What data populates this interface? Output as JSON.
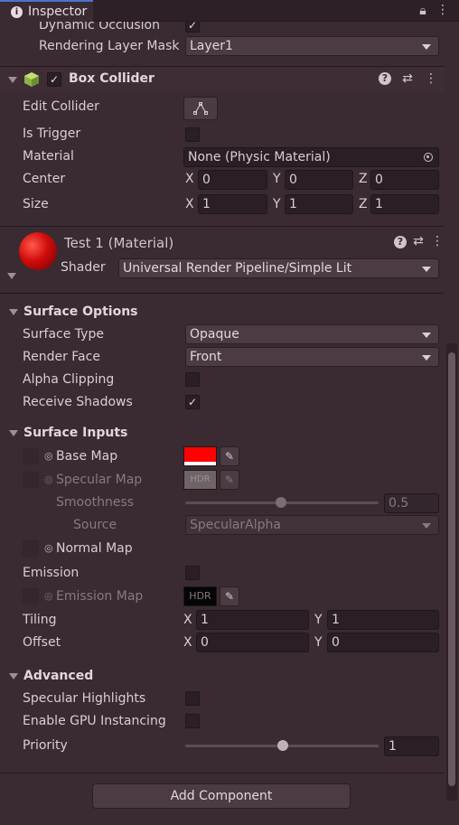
{
  "tab": {
    "title": "Inspector"
  },
  "partial_rows": {
    "dynamic_occlusion": "Dynamic Occlusion",
    "rendering_layer_mask": {
      "label": "Rendering Layer Mask",
      "value": "Layer1"
    }
  },
  "box_collider": {
    "title": "Box Collider",
    "edit_collider": "Edit Collider",
    "is_trigger": "Is Trigger",
    "material": {
      "label": "Material",
      "value": "None (Physic Material)"
    },
    "center": {
      "label": "Center",
      "x": "0",
      "y": "0",
      "z": "0"
    },
    "size": {
      "label": "Size",
      "x": "1",
      "y": "1",
      "z": "1"
    }
  },
  "material": {
    "title": "Test 1 (Material)",
    "shader_label": "Shader",
    "shader_value": "Universal Render Pipeline/Simple Lit",
    "preview_color": "#d10b0b"
  },
  "surface_options": {
    "title": "Surface Options",
    "surface_type": {
      "label": "Surface Type",
      "value": "Opaque"
    },
    "render_face": {
      "label": "Render Face",
      "value": "Front"
    },
    "alpha_clipping": "Alpha Clipping",
    "receive_shadows": "Receive Shadows"
  },
  "surface_inputs": {
    "title": "Surface Inputs",
    "base_map": {
      "label": "Base Map",
      "color": "#ff0000"
    },
    "specular_map": {
      "label": "Specular Map",
      "badge": "HDR"
    },
    "smoothness": {
      "label": "Smoothness",
      "value": "0.5"
    },
    "source": {
      "label": "Source",
      "value": "SpecularAlpha"
    },
    "normal_map": "Normal Map",
    "emission": "Emission",
    "emission_map": {
      "label": "Emission Map",
      "badge": "HDR"
    },
    "tiling": {
      "label": "Tiling",
      "x": "1",
      "y": "1"
    },
    "offset": {
      "label": "Offset",
      "x": "0",
      "y": "0"
    }
  },
  "advanced": {
    "title": "Advanced",
    "specular_highlights": "Specular Highlights",
    "gpu_instancing": "Enable GPU Instancing",
    "priority": {
      "label": "Priority",
      "value": "1"
    }
  },
  "axes": {
    "x": "X",
    "y": "Y",
    "z": "Z"
  },
  "add_component": "Add Component",
  "checkmark": "✓",
  "icons": {
    "help": "?",
    "presets": "⇄",
    "more": "⋮",
    "lock": "🔓",
    "eyedropper": "✎",
    "collider_edit": "⏶"
  }
}
